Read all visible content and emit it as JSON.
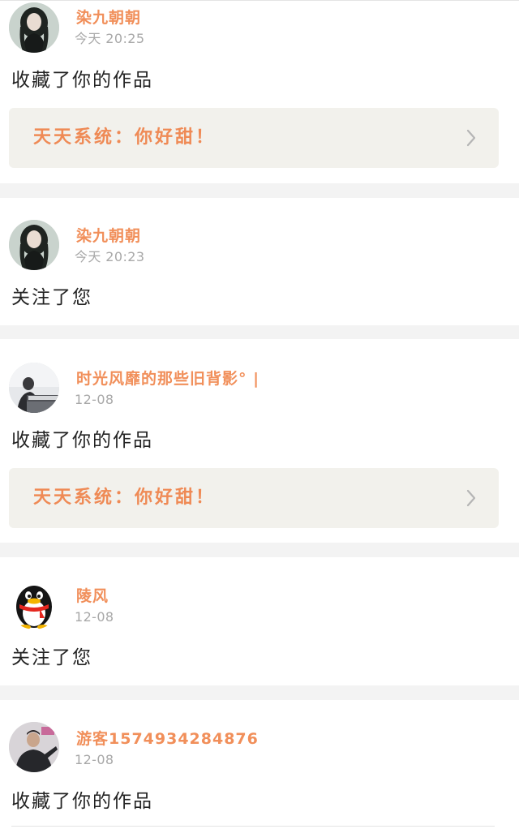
{
  "notifications": [
    {
      "user": "染九朝朝",
      "time": "今天 20:25",
      "action": "收藏了你的作品",
      "reference": "天天系统：你好甜！",
      "avatar": "girl-portrait-avatar"
    },
    {
      "user": "染九朝朝",
      "time": "今天 20:23",
      "action": "关注了您",
      "avatar": "girl-portrait-avatar"
    },
    {
      "user": "时光风靡的那些旧背影° |",
      "time": "12-08",
      "action": "收藏了你的作品",
      "reference": "天天系统：你好甜！",
      "avatar": "person-at-piano-avatar"
    },
    {
      "user": "陵风",
      "time": "12-08",
      "action": "关注了您",
      "avatar": "qq-penguin-avatar"
    },
    {
      "user": "游客1574934284876",
      "time": "12-08",
      "action": "收藏了你的作品",
      "avatar": "man-portrait-avatar"
    }
  ],
  "colors": {
    "username": "#f18f5a",
    "reference_text": "#ef8a55",
    "reference_bg": "#f2f1ec",
    "time": "#a8a8a8",
    "action_text": "#232323",
    "separator_bg": "#f3f3f3"
  }
}
